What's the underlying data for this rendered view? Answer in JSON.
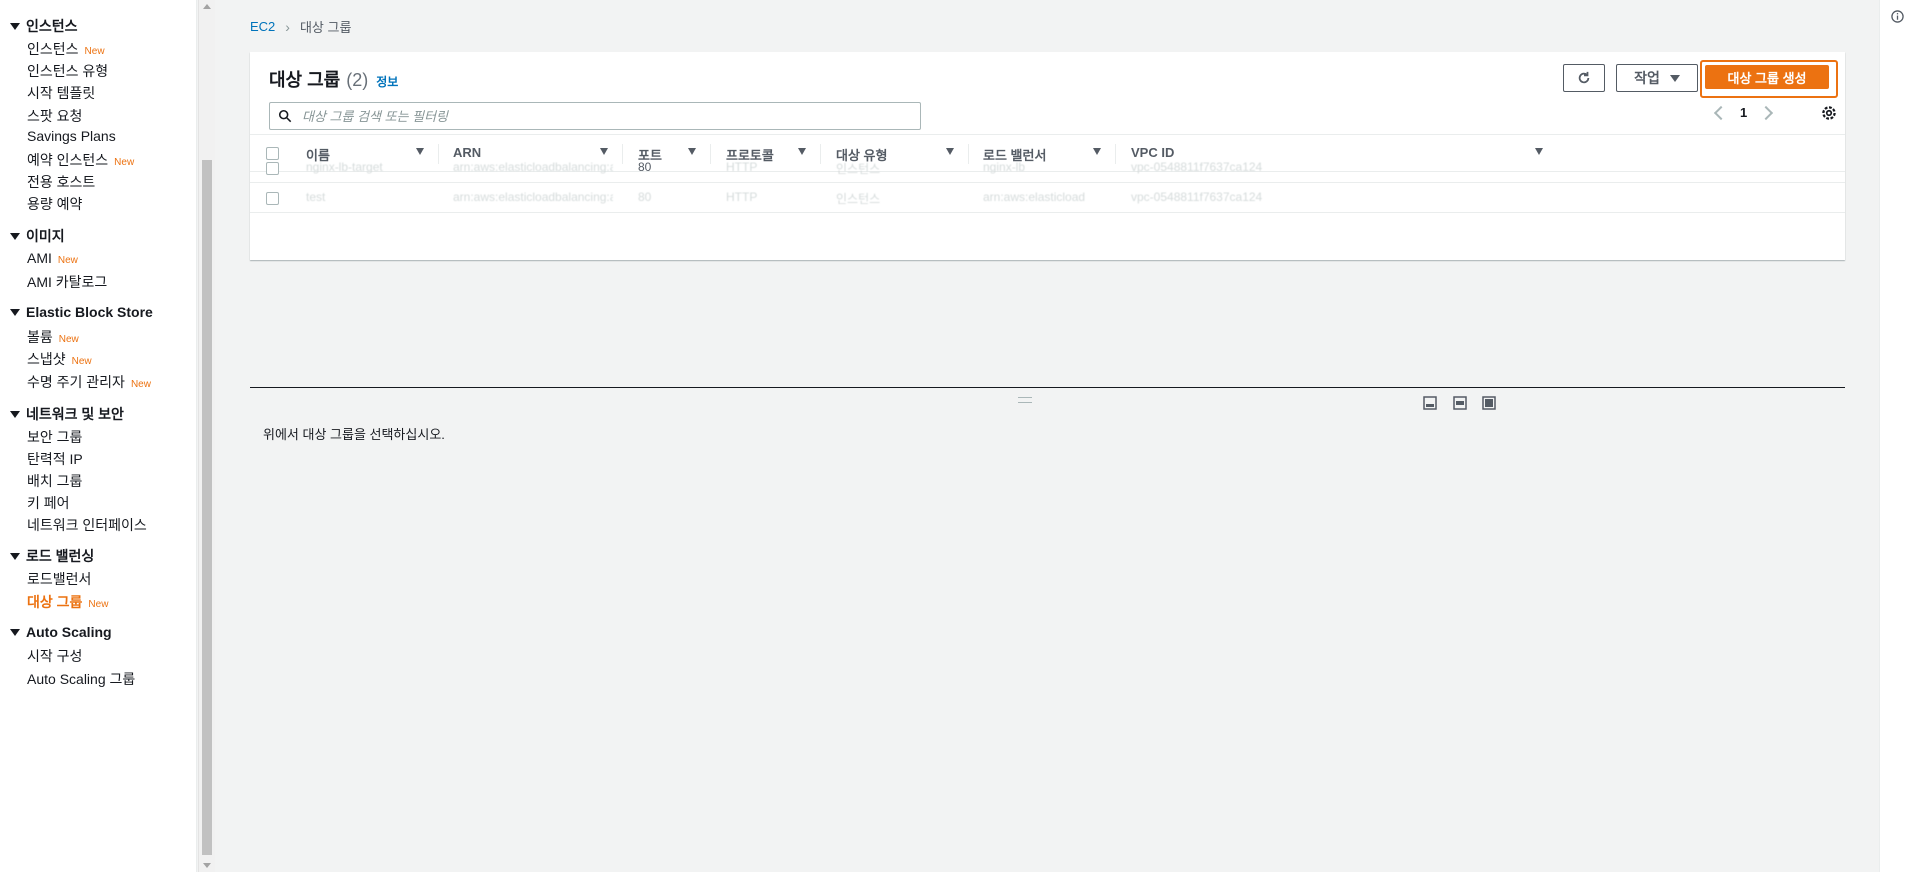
{
  "sidebar": {
    "sections": [
      {
        "title": "인스턴스",
        "items": [
          {
            "label": "인스턴스",
            "badge": "New"
          },
          {
            "label": "인스턴스 유형",
            "badge": ""
          },
          {
            "label": "시작 템플릿",
            "badge": ""
          },
          {
            "label": "스팟 요청",
            "badge": ""
          },
          {
            "label": "Savings Plans",
            "badge": ""
          },
          {
            "label": "예약 인스턴스",
            "badge": "New"
          },
          {
            "label": "전용 호스트",
            "badge": ""
          },
          {
            "label": "용량 예약",
            "badge": ""
          }
        ]
      },
      {
        "title": "이미지",
        "items": [
          {
            "label": "AMI",
            "badge": "New"
          },
          {
            "label": "AMI 카탈로그",
            "badge": ""
          }
        ]
      },
      {
        "title": "Elastic Block Store",
        "items": [
          {
            "label": "볼륨",
            "badge": "New"
          },
          {
            "label": "스냅샷",
            "badge": "New"
          },
          {
            "label": "수명 주기 관리자",
            "badge": "New"
          }
        ]
      },
      {
        "title": "네트워크 및 보안",
        "items": [
          {
            "label": "보안 그룹",
            "badge": ""
          },
          {
            "label": "탄력적 IP",
            "badge": ""
          },
          {
            "label": "배치 그룹",
            "badge": ""
          },
          {
            "label": "키 페어",
            "badge": ""
          },
          {
            "label": "네트워크 인터페이스",
            "badge": ""
          }
        ]
      },
      {
        "title": "로드 밸런싱",
        "items": [
          {
            "label": "로드밸런서",
            "badge": ""
          },
          {
            "label": "대상 그룹",
            "badge": "New",
            "active": true
          }
        ]
      },
      {
        "title": "Auto Scaling",
        "items": [
          {
            "label": "시작 구성",
            "badge": ""
          },
          {
            "label": "Auto Scaling 그룹",
            "badge": ""
          }
        ]
      }
    ]
  },
  "breadcrumb": {
    "root": "EC2",
    "current": "대상 그룹"
  },
  "panel": {
    "title": "대상 그룹",
    "count": "(2)",
    "info": "정보",
    "actions_label": "작업",
    "create_label": "대상 그룹 생성",
    "search_placeholder": "대상 그룹 검색 또는 필터링",
    "page": "1"
  },
  "table": {
    "columns": [
      "이름",
      "ARN",
      "포트",
      "프로토콜",
      "대상 유형",
      "로드 밸런서",
      "VPC ID"
    ],
    "rows": [
      {
        "name": "nginx-lb-target",
        "arn": "arn:aws:elasticloadbalancing:ap",
        "port": "80",
        "protocol": "HTTP",
        "type": "인스턴스",
        "lb": "nginx-lb",
        "vpc": "vpc-0548811f7637ca124"
      },
      {
        "name": "test",
        "arn": "arn:aws:elasticloadbalancing:ap",
        "port": "80",
        "protocol": "HTTP",
        "type": "인스턴스",
        "lb": "arn:aws:elasticload",
        "vpc": "vpc-0548811f7637ca124"
      }
    ]
  },
  "split_panel": {
    "message": "위에서 대상 그룹을 선택하십시오."
  },
  "colors": {
    "accent": "#ec7211",
    "link": "#0073bb"
  }
}
